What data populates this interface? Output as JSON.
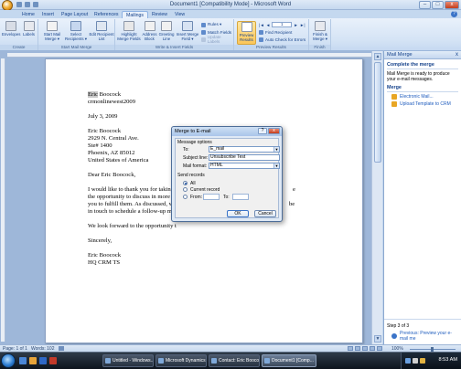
{
  "window": {
    "title": "Document1 [Compatibility Mode] - Microsoft Word",
    "buttons": [
      "–",
      "□",
      "x"
    ]
  },
  "ribbon_tabs": [
    "Home",
    "Insert",
    "Page Layout",
    "References",
    "Mailings",
    "Review",
    "View"
  ],
  "active_tab": "Mailings",
  "ribbon": {
    "create": {
      "label": "Create",
      "envelopes": "Envelopes",
      "labels": "Labels"
    },
    "start": {
      "label": "Start Mail Merge",
      "start_merge": "Start Mail Merge ▾",
      "select_recipients": "Select Recipients ▾",
      "edit_list": "Edit Recipient List"
    },
    "write": {
      "label": "Write & Insert Fields",
      "highlight": "Highlight Merge Fields",
      "address": "Address Block",
      "greeting": "Greeting Line",
      "insert_field": "Insert Merge Field ▾",
      "rules": "Rules ▾",
      "match": "Match Fields",
      "update": "Update Labels"
    },
    "preview": {
      "label": "Preview Results",
      "preview_btn": "Preview Results",
      "record": "1",
      "find": "Find Recipient",
      "auto_check": "Auto Check for Errors"
    },
    "finish": {
      "label": "Finish",
      "finish_btn": "Finish & Merge ▾"
    }
  },
  "document": {
    "name_line1": "Eric",
    "name_line1_rest": " Boocock",
    "line2": "crmonlinewest2009",
    "date": "July 3, 2009",
    "addr1": "Eric Boocock",
    "addr2": "2929 N. Central Ave.",
    "addr3": "Ste# 1400",
    "addr4": "Phoenix, AZ 85012",
    "addr5": "United States of America",
    "salutation": "Dear Eric Boocock,",
    "para1_l1": "I would like to thank you for taking t",
    "para1_l1_end": "e",
    "para1_l2": "the opportunity to discuss in more d",
    "para1_l3": "you to fulfill them. As discussed, we",
    "para1_l3_end": "be",
    "para1_l4": "in touch to schedule a follow-up me",
    "para2": "We look forward to the opportunity t",
    "closing": "Sincerely,",
    "sig1": "Eric Boocock",
    "sig2": "HQ CRM TS"
  },
  "dialog": {
    "title": "Merge to E-mail",
    "help": "?",
    "close": "x",
    "message_options": "Message options",
    "to_label": "To:",
    "to_value": "E_mail",
    "subject_label": "Subject line:",
    "subject_value": "Unsubscribe Test",
    "format_label": "Mail format:",
    "format_value": "HTML",
    "send_records": "Send records",
    "all": "All",
    "current": "Current record",
    "from": "From:",
    "to2": "To:",
    "ok": "OK",
    "cancel": "Cancel"
  },
  "task_pane": {
    "title": "Mail Merge",
    "close": "x",
    "complete": "Complete the merge",
    "complete_text": "Mail Merge is ready to produce your e-mail messages.",
    "merge": "Merge",
    "electronic": "Electronic Mail...",
    "upload": "Upload Template to CRM",
    "step": "Step 3 of 3",
    "previous": "Previous: Preview your e-mail me"
  },
  "statusbar": {
    "page": "Page: 1 of 1",
    "words": "Words: 102",
    "zoom": "100%"
  },
  "taskbar": {
    "buttons": [
      "Untitled - Windows...",
      "Microsoft Dynamics...",
      "Contact: Eric Boocoo...",
      "Document1 [Comp..."
    ],
    "clock": "8:53 AM"
  },
  "colors": {
    "accent": "#15428b",
    "preview_active": "#fbc659",
    "taskbar": "#1a2431"
  }
}
